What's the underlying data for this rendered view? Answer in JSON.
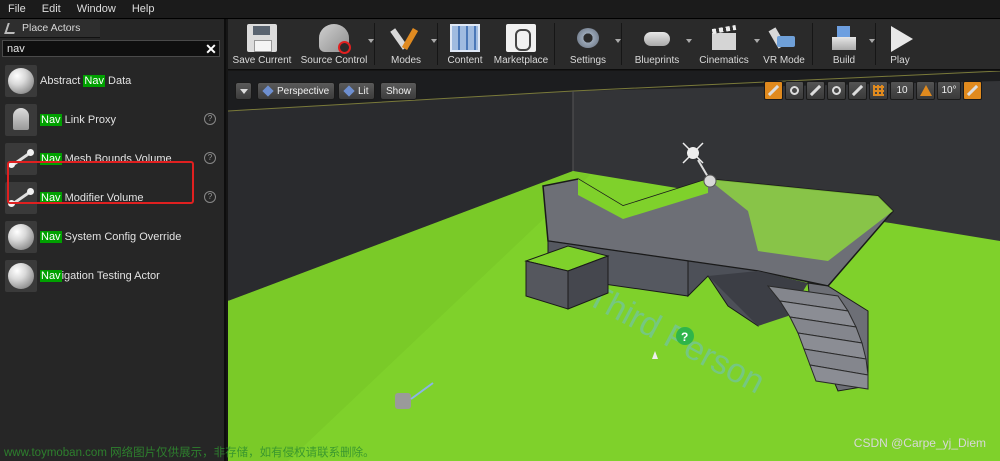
{
  "menubar": {
    "items": [
      "File",
      "Edit",
      "Window",
      "Help"
    ]
  },
  "panel": {
    "tab_label": "Place Actors",
    "search": {
      "value": "nav"
    },
    "items": [
      {
        "pre": "Abstract ",
        "hl": "Nav",
        "post": " Data",
        "icon": "sphere-icon"
      },
      {
        "pre": "",
        "hl": "Nav",
        "post": " Link Proxy",
        "icon": "figure-icon"
      },
      {
        "pre": "",
        "hl": "Nav",
        "post": " Mesh Bounds Volume",
        "icon": "volume-icon"
      },
      {
        "pre": "",
        "hl": "Nav",
        "post": " Modifier Volume",
        "icon": "volume-icon"
      },
      {
        "pre": "",
        "hl": "Nav",
        "post": " System Config Override",
        "icon": "sphere-icon"
      },
      {
        "pre": "",
        "hl": "Nav",
        "post": "igation Testing Actor",
        "icon": "sphere-icon"
      }
    ],
    "highlight_color": "#00a000",
    "selection_box_color": "#e02020"
  },
  "toolbar": {
    "items": [
      {
        "label": "Save Current",
        "icon": "save-icon"
      },
      {
        "label": "Source Control",
        "icon": "source-control-icon"
      },
      {
        "label": "Modes",
        "icon": "modes-icon"
      },
      {
        "label": "Content",
        "icon": "content-icon"
      },
      {
        "label": "Marketplace",
        "icon": "marketplace-icon"
      },
      {
        "label": "Settings",
        "icon": "settings-icon"
      },
      {
        "label": "Blueprints",
        "icon": "blueprints-icon"
      },
      {
        "label": "Cinematics",
        "icon": "cinematics-icon"
      },
      {
        "label": "VR Mode",
        "icon": "vr-mode-icon"
      },
      {
        "label": "Build",
        "icon": "build-icon"
      },
      {
        "label": "Play",
        "icon": "play-icon"
      }
    ]
  },
  "viewport": {
    "perspective_label": "Perspective",
    "lit_label": "Lit",
    "show_label": "Show",
    "grid_snap_value": "10",
    "rotation_snap_value": "10°",
    "floor_text": "Third Person",
    "floor_color": "#7fd12b"
  },
  "overlay": {
    "watermark": "www.toymoban.com 网络图片仅供展示，非存储，如有侵权请联系删除。",
    "credit": "CSDN @Carpe_yj_Diem"
  }
}
